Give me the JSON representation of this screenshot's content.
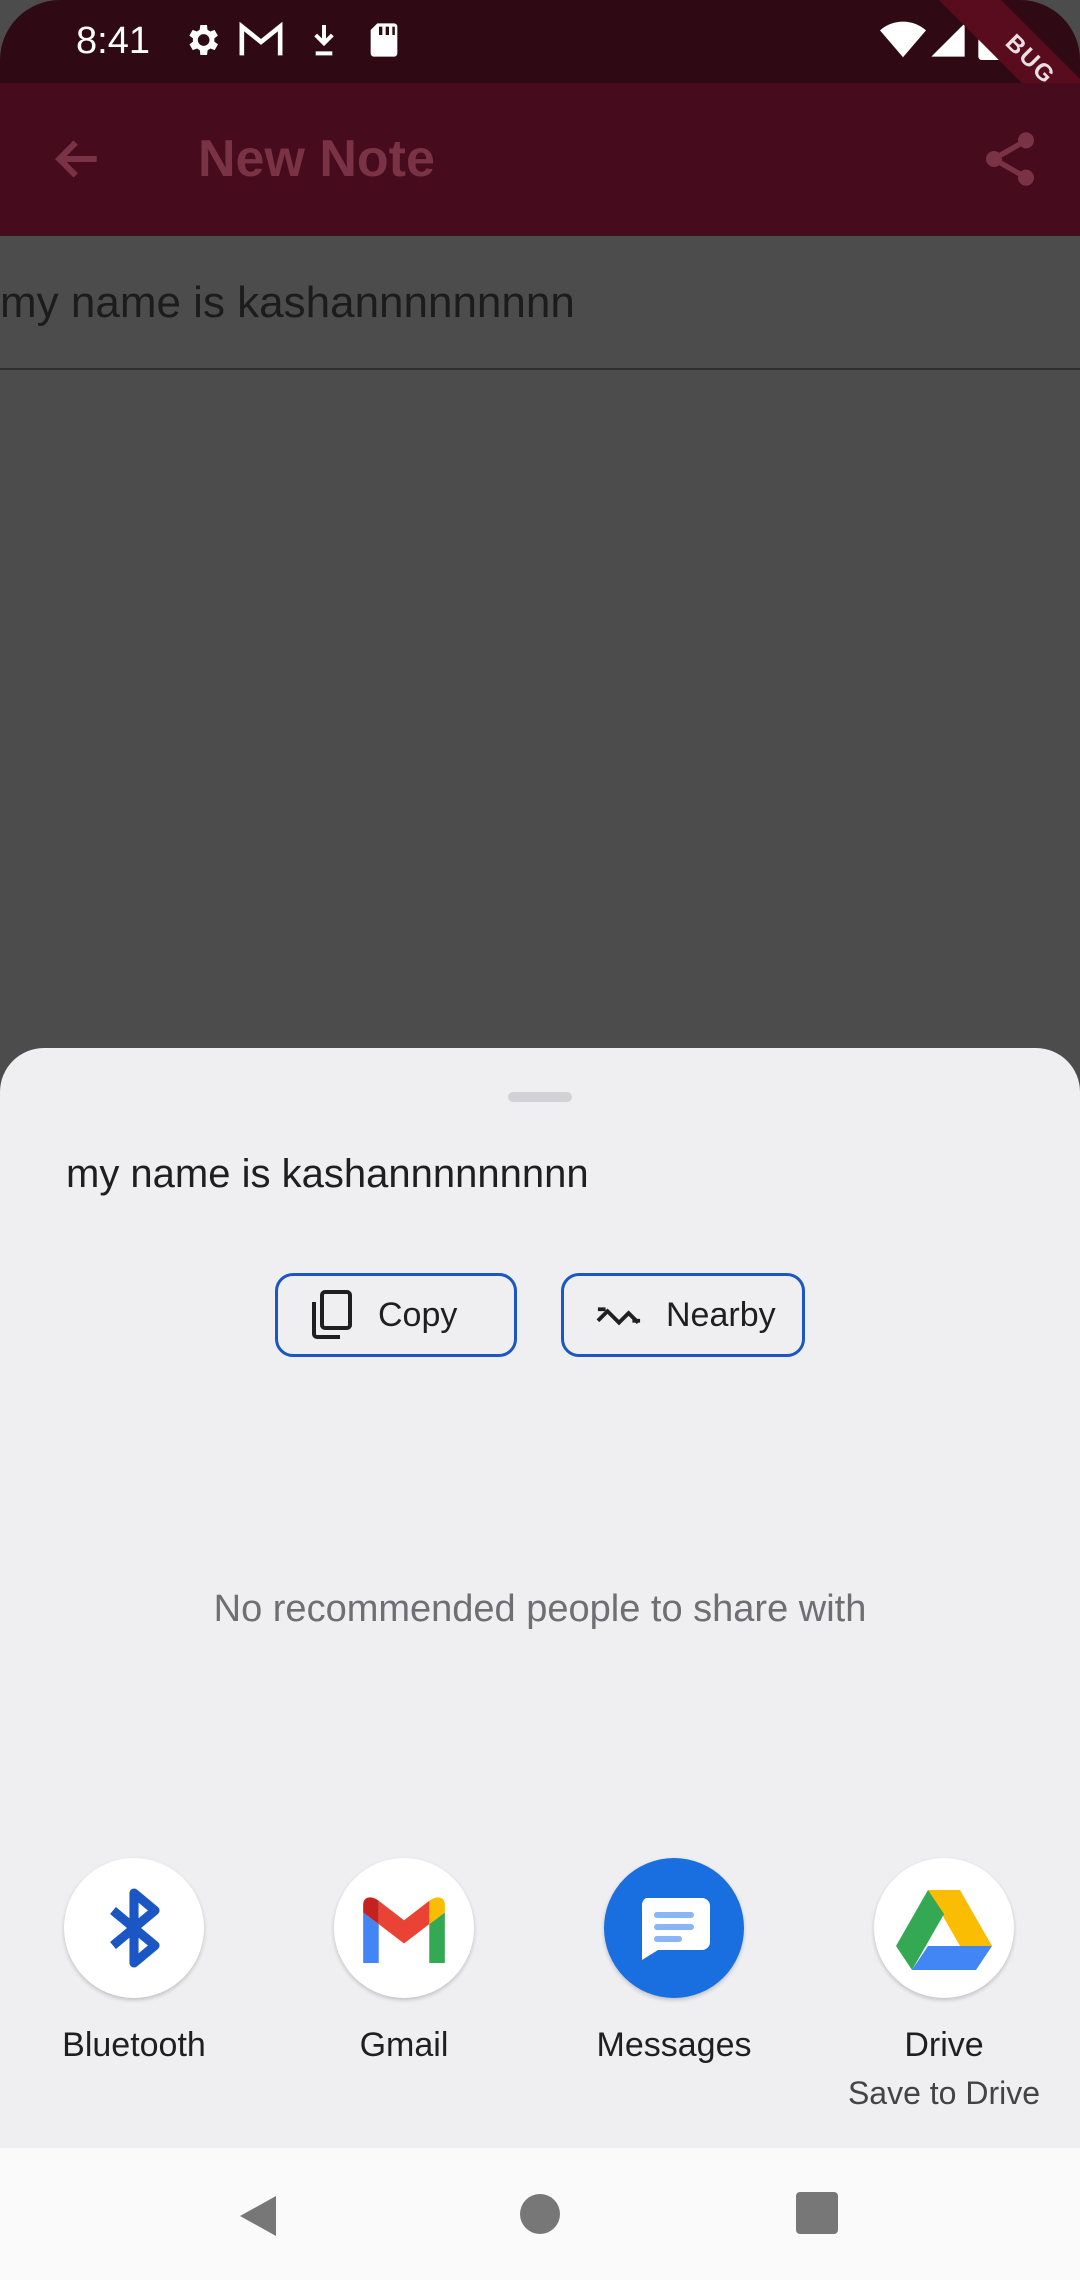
{
  "status_bar": {
    "time": "8:41",
    "icons": [
      "gear-icon",
      "gmail-icon",
      "download-icon",
      "sd-card-icon",
      "wifi-icon",
      "signal-icon",
      "battery-icon"
    ],
    "debug_ribbon": "BUG"
  },
  "app_bar": {
    "title": "New Note",
    "back_icon": "arrow-back-icon",
    "share_icon": "share-icon"
  },
  "note": {
    "text": "my name is kashannnnnnnnn"
  },
  "share_sheet": {
    "shared_text": "my name is kashannnnnnnnn",
    "actions": [
      {
        "label": "Copy",
        "icon": "copy-icon"
      },
      {
        "label": "Nearby",
        "icon": "nearby-icon"
      }
    ],
    "no_recommendations": "No recommended people to share with",
    "apps": [
      {
        "label": "Bluetooth",
        "sublabel": "",
        "icon": "bluetooth-icon"
      },
      {
        "label": "Gmail",
        "sublabel": "",
        "icon": "gmail-icon"
      },
      {
        "label": "Messages",
        "sublabel": "",
        "icon": "messages-icon"
      },
      {
        "label": "Drive",
        "sublabel": "Save to Drive",
        "icon": "drive-icon"
      }
    ]
  },
  "nav_bar": {
    "buttons": [
      "back-triangle-icon",
      "home-circle-icon",
      "recents-square-icon"
    ]
  },
  "colors": {
    "app_bar": "#470b1e",
    "status_bar": "#2f0a14",
    "scrim": "#4c4c4c",
    "sheet": "#efeff2",
    "chip_border": "#1a56c4"
  }
}
